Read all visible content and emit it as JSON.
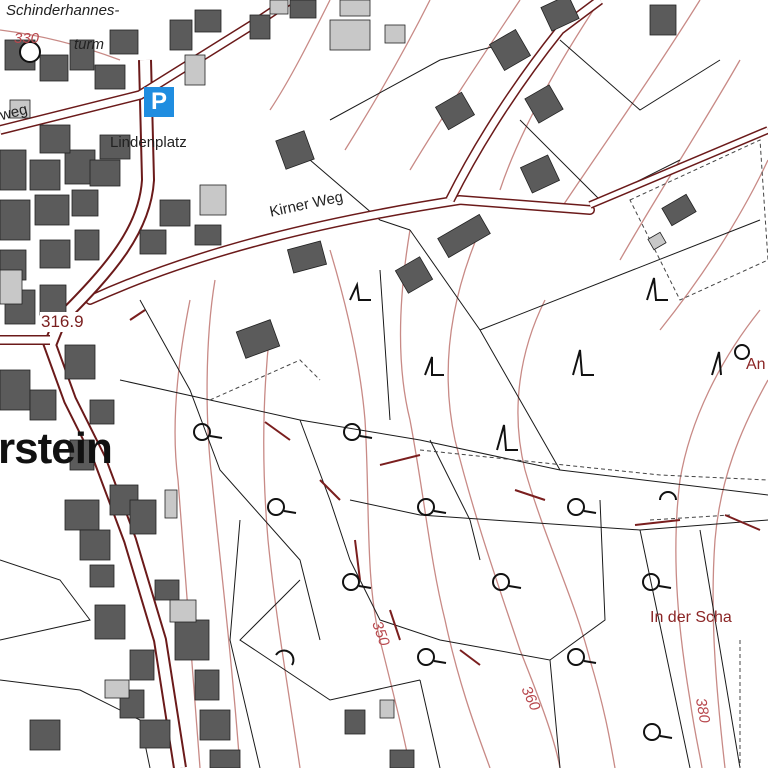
{
  "map": {
    "labels": {
      "tower_line1": "Schinderhannes-",
      "tower_line2": "turm",
      "lindenplatz": "Lindenplatz",
      "kirner_weg": "Kirner Weg",
      "weg_fragment": "weg",
      "town_fragment": "rstein",
      "field_name": "In der Scha",
      "field_fragment_right": "An"
    },
    "parking_symbol": "P",
    "spot_height": "316.9",
    "contour_labels": [
      "330",
      "350",
      "360",
      "380"
    ],
    "colors": {
      "building": "#5b5b5b",
      "building_light": "#c8c8c8",
      "road_edge": "#6b1a1a",
      "contour": "#c88a86",
      "parcel": "#1a1a1a",
      "parking": "#1f8de0"
    },
    "symbols": {
      "deciduous_tree": "tree-circle-icon",
      "conifer_tree": "tree-triangle-icon"
    }
  }
}
